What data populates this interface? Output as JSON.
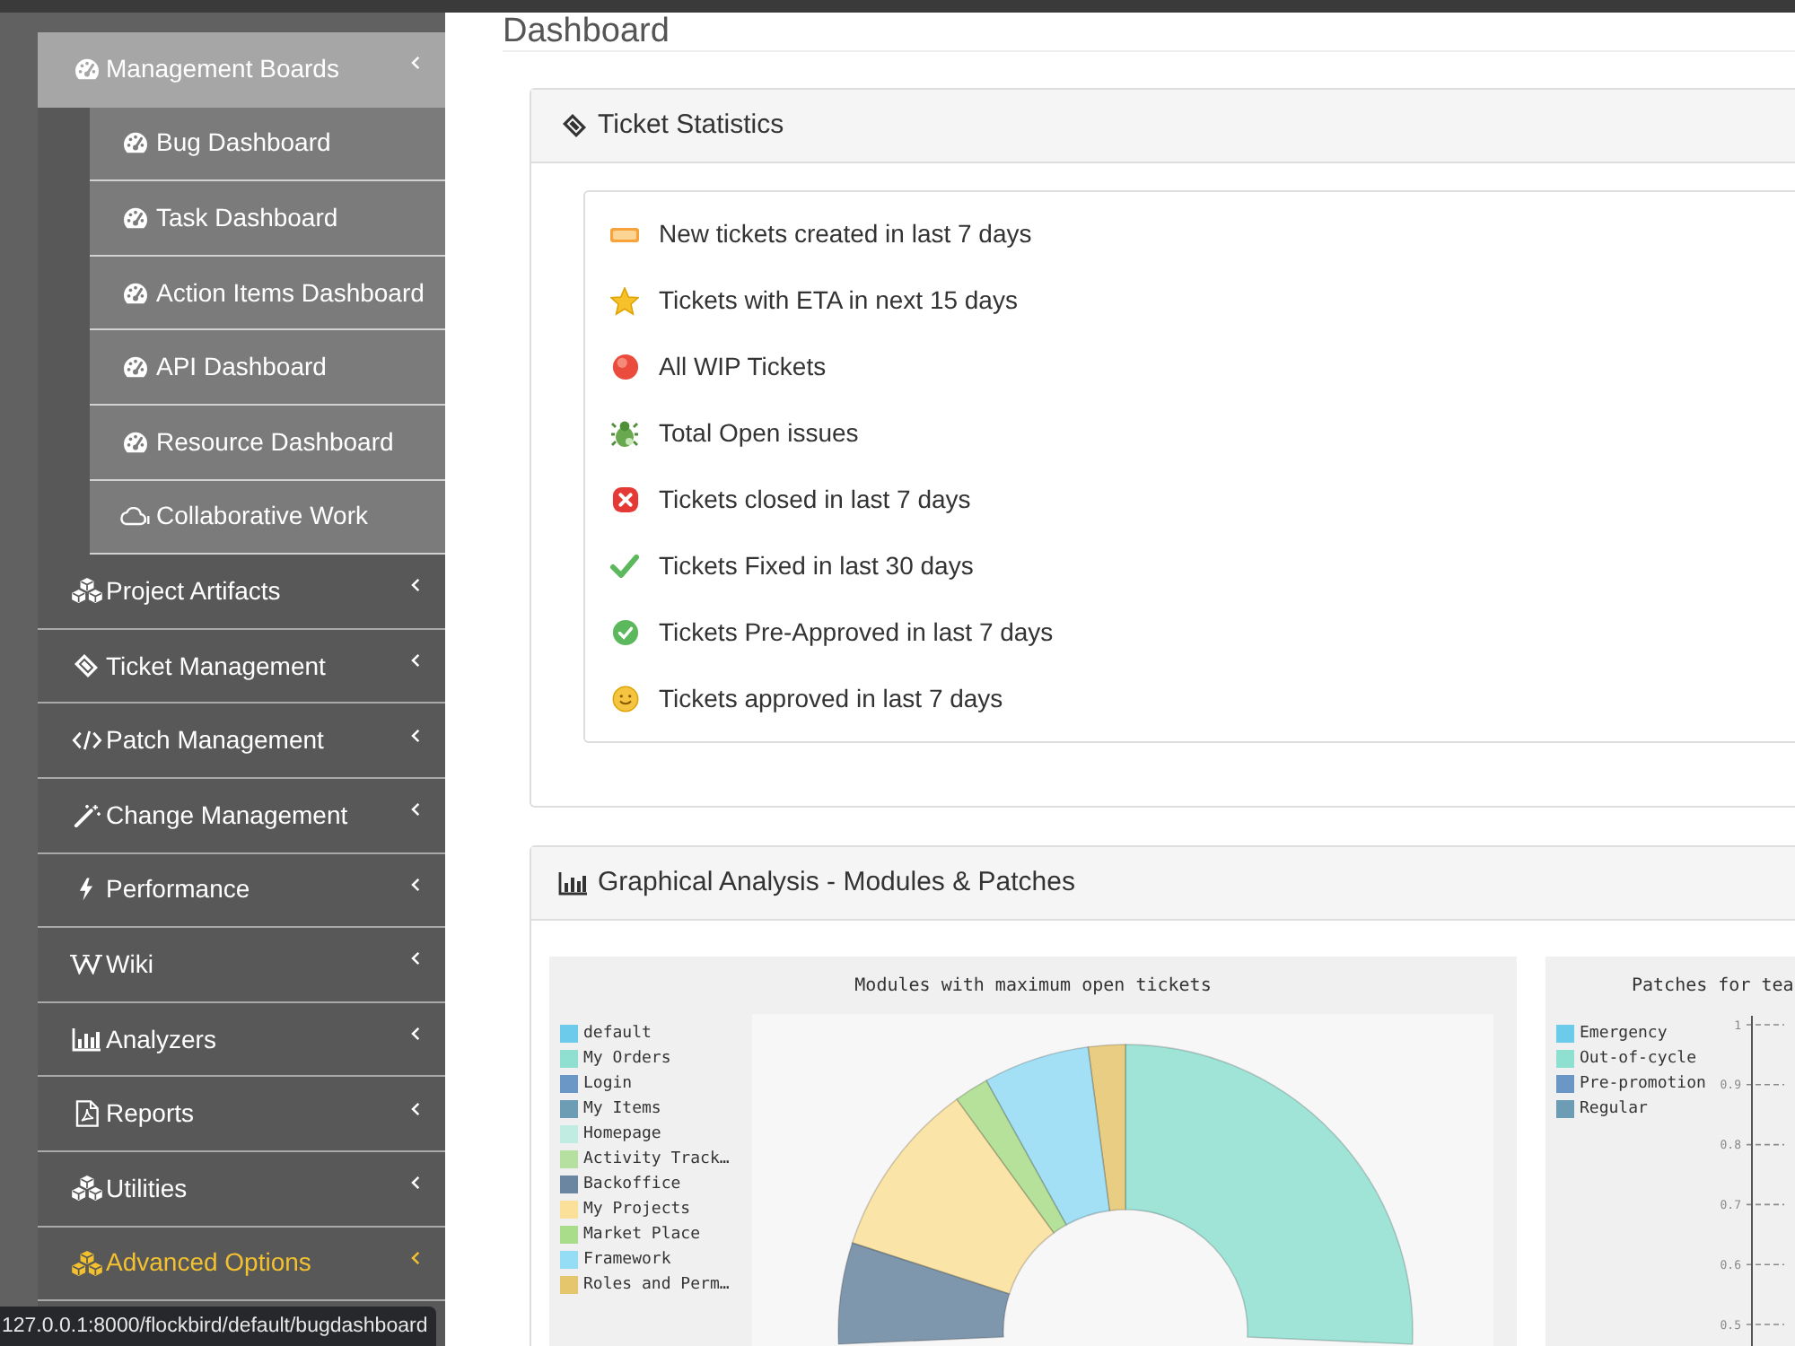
{
  "sidebar": {
    "items": [
      {
        "label": "Management Boards",
        "expanded": true,
        "highlighted": false,
        "children": [
          {
            "label": "Bug Dashboard"
          },
          {
            "label": "Task Dashboard"
          },
          {
            "label": "Action Items Dashboard"
          },
          {
            "label": "API Dashboard"
          },
          {
            "label": "Resource Dashboard"
          },
          {
            "label": "Collaborative Work"
          }
        ]
      },
      {
        "label": "Project Artifacts",
        "expanded": false,
        "highlighted": false
      },
      {
        "label": "Ticket Management",
        "expanded": false,
        "highlighted": false
      },
      {
        "label": "Patch Management",
        "expanded": false,
        "highlighted": false
      },
      {
        "label": "Change Management",
        "expanded": false,
        "highlighted": false
      },
      {
        "label": "Performance",
        "expanded": false,
        "highlighted": false
      },
      {
        "label": "Wiki",
        "expanded": false,
        "highlighted": false
      },
      {
        "label": "Analyzers",
        "expanded": false,
        "highlighted": false
      },
      {
        "label": "Reports",
        "expanded": false,
        "highlighted": false
      },
      {
        "label": "Utilities",
        "expanded": false,
        "highlighted": false
      },
      {
        "label": "Advanced Options",
        "expanded": false,
        "highlighted": true
      }
    ]
  },
  "page": {
    "title": "Dashboard"
  },
  "ticket_statistics": {
    "title": "Ticket Statistics",
    "items": [
      "New tickets created in last 7 days",
      "Tickets with ETA in next 15 days",
      "All WIP Tickets",
      "Total Open issues",
      "Tickets closed in last 7 days",
      "Tickets Fixed in last 30 days",
      "Tickets Pre-Approved in last 7 days",
      "Tickets approved in last 7 days"
    ]
  },
  "graphical_analysis": {
    "title": "Graphical Analysis - Modules & Patches",
    "modules_chart": {
      "title": "Modules with maximum open tickets",
      "legend": [
        {
          "label": "default",
          "color": "#6ccbea"
        },
        {
          "label": "My Orders",
          "color": "#8fe0d1"
        },
        {
          "label": "Login",
          "color": "#6b97c6"
        },
        {
          "label": "My Items",
          "color": "#6d9db5"
        },
        {
          "label": "Homepage",
          "color": "#c1ece2"
        },
        {
          "label": "Activity Track…",
          "color": "#b6e0a0"
        },
        {
          "label": "Backoffice",
          "color": "#6a86a0"
        },
        {
          "label": "My Projects",
          "color": "#fbe099"
        },
        {
          "label": "Market Place",
          "color": "#a9dd89"
        },
        {
          "label": "Framework",
          "color": "#95dcf5"
        },
        {
          "label": "Roles and Perm…",
          "color": "#e6c66d"
        }
      ]
    },
    "patches_chart": {
      "title": "Patches for tea",
      "legend": [
        {
          "label": "Emergency",
          "color": "#6ccbea"
        },
        {
          "label": "Out-of-cycle",
          "color": "#8fe0d1"
        },
        {
          "label": "Pre-promotion",
          "color": "#6b97c6"
        },
        {
          "label": "Regular",
          "color": "#6d9db5"
        }
      ],
      "y_axis_labels": [
        "1",
        "0.9",
        "0.8",
        "0.7",
        "0.6",
        "0.5"
      ]
    }
  },
  "status_bar": {
    "url": "127.0.0.1:8000/flockbird/default/bugdashboard"
  }
}
